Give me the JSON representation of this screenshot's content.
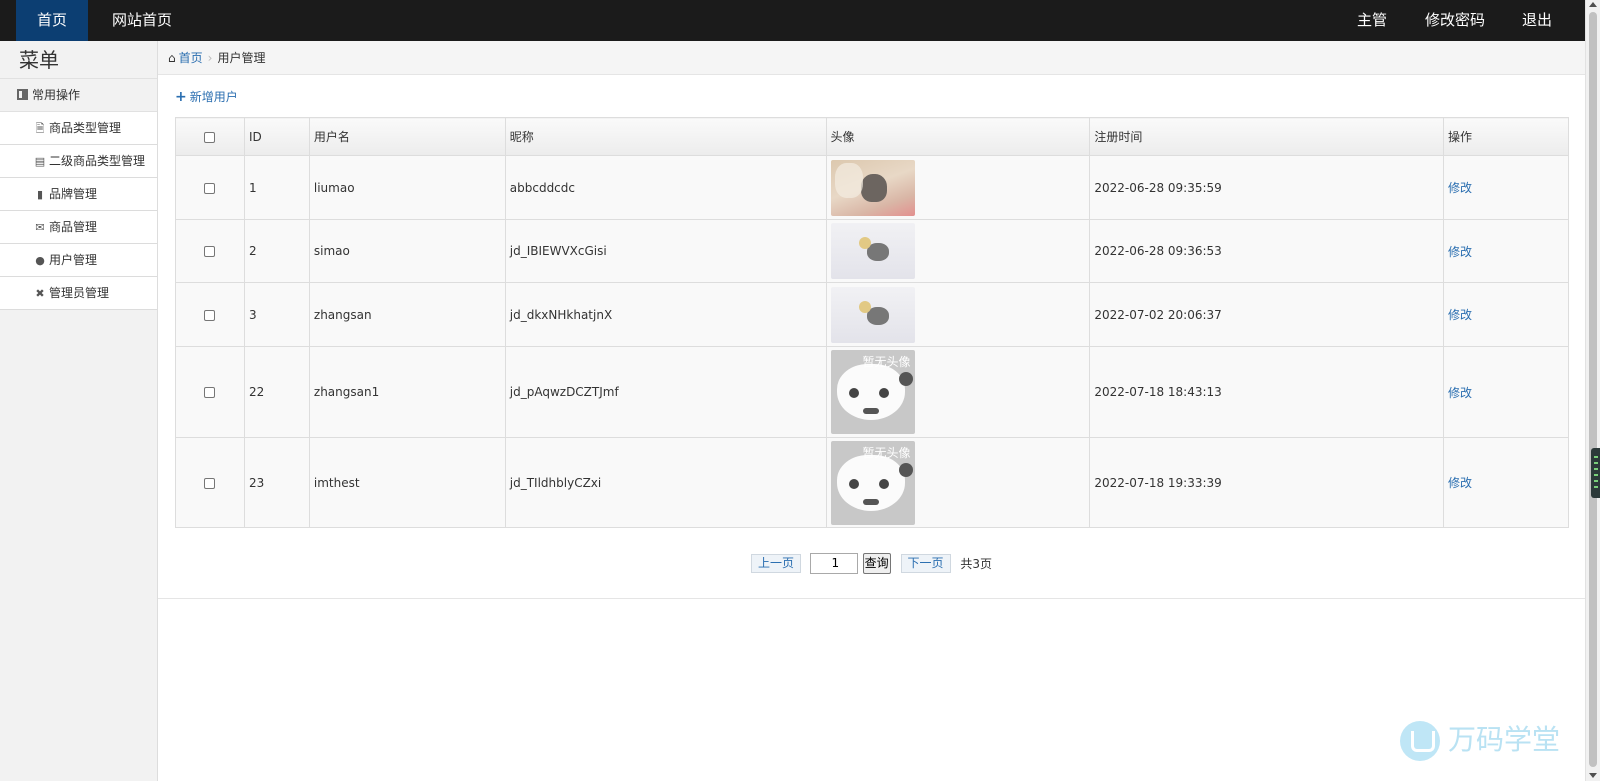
{
  "topnav": {
    "home": "首页",
    "site_home": "网站首页",
    "user": "主管",
    "change_password": "修改密码",
    "logout": "退出"
  },
  "sidebar": {
    "title": "菜单",
    "group": "常用操作",
    "items": [
      {
        "label": "商品类型管理",
        "icon": "file-icon"
      },
      {
        "label": "二级商品类型管理",
        "icon": "list-icon"
      },
      {
        "label": "品牌管理",
        "icon": "truck-icon"
      },
      {
        "label": "商品管理",
        "icon": "envelope-icon"
      },
      {
        "label": "用户管理",
        "icon": "comment-icon"
      },
      {
        "label": "管理员管理",
        "icon": "wrench-icon"
      }
    ]
  },
  "breadcrumb": {
    "home": "首页",
    "current": "用户管理"
  },
  "toolbar": {
    "add_user": "新增用户"
  },
  "table": {
    "columns": [
      "ID",
      "用户名",
      "昵称",
      "头像",
      "注册时间",
      "操作"
    ],
    "rows": [
      {
        "id": "1",
        "username": "liumao",
        "nickname": "abbcddcdc",
        "avatar": "cat-photo",
        "registered": "2022-06-28 09:35:59",
        "action": "修改"
      },
      {
        "id": "2",
        "username": "simao",
        "nickname": "jd_IBIEWVXcGisi",
        "avatar": "kitten-photo",
        "registered": "2022-06-28 09:36:53",
        "action": "修改"
      },
      {
        "id": "3",
        "username": "zhangsan",
        "nickname": "jd_dkxNHkhatjnX",
        "avatar": "kitten-photo",
        "registered": "2022-07-02 20:06:37",
        "action": "修改"
      },
      {
        "id": "22",
        "username": "zhangsan1",
        "nickname": "jd_pAqwzDCZTJmf",
        "avatar": "default-avatar",
        "registered": "2022-07-18 18:43:13",
        "action": "修改"
      },
      {
        "id": "23",
        "username": "imthest",
        "nickname": "jd_TIldhblyCZxi",
        "avatar": "default-avatar",
        "registered": "2022-07-18 19:33:39",
        "action": "修改"
      }
    ],
    "default_avatar_text": "暂无头像"
  },
  "pager": {
    "prev": "上一页",
    "page_value": "1",
    "query": "查询",
    "next": "下一页",
    "total": "共3页"
  },
  "watermark": {
    "text": "万码学堂"
  }
}
